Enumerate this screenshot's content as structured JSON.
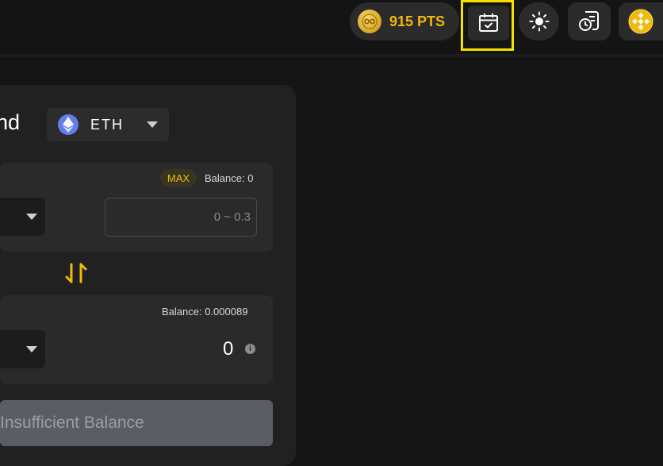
{
  "header": {
    "points": {
      "value_label": "915 PTS"
    },
    "icons": [
      "coin-icon",
      "calendar-check-icon",
      "sun-icon",
      "history-doc-icon",
      "bnb-icon"
    ],
    "colors": {
      "accent": "#f0b90b",
      "highlight": "#f5e100"
    }
  },
  "form": {
    "title_partial": "end",
    "token": {
      "symbol": "ETH"
    },
    "from": {
      "max_label": "MAX",
      "balance_text": "Balance: 0",
      "amount_placeholder": "0 ~ 0.3",
      "amount_value": ""
    },
    "to": {
      "balance_text": "Balance: 0.000089",
      "amount": "0"
    },
    "submit_label": "Insufficient Balance"
  }
}
